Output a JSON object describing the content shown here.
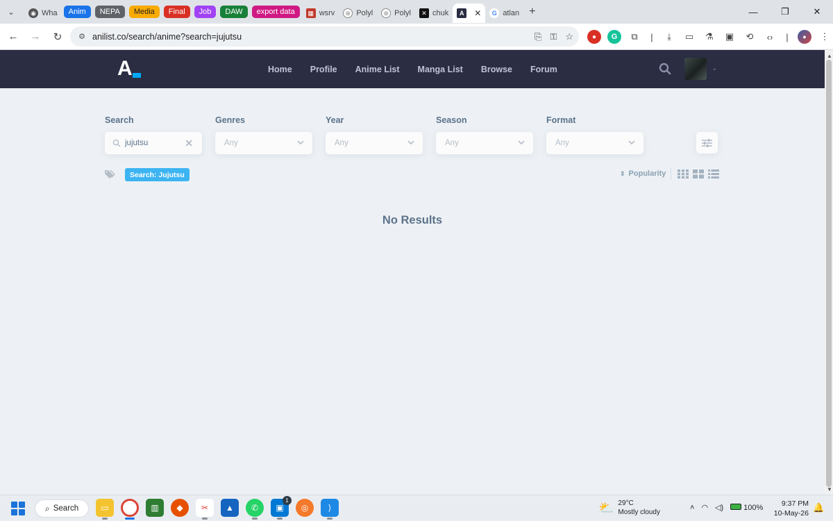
{
  "browser": {
    "tabs": [
      {
        "label": "Wha",
        "icon": "chrome-icon",
        "color": "#555555"
      },
      {
        "label": "Polyl",
        "icon": "globe-icon",
        "color": "#888888"
      },
      {
        "label": "Polyl",
        "icon": "globe-icon",
        "color": "#888888"
      },
      {
        "label": "chuk",
        "icon": "x-icon",
        "color": "#111111"
      },
      {
        "label": "wsrv",
        "icon": "image-icon",
        "color": "#c0392b"
      }
    ],
    "groups": [
      {
        "label": "Anim",
        "color": "#1a73e8"
      },
      {
        "label": "NEPA",
        "color": "#5f6368"
      },
      {
        "label": "Media",
        "color": "#f9ab00"
      },
      {
        "label": "Final",
        "color": "#d93025"
      },
      {
        "label": "Job",
        "color": "#a142f4"
      },
      {
        "label": "DAW",
        "color": "#188038"
      },
      {
        "label": "export data",
        "color": "#d01884"
      }
    ],
    "active_tab_label": "",
    "last_tab_label": "atlan",
    "url": "anilist.co/search/anime?search=jujutsu"
  },
  "site": {
    "logo": "A",
    "nav": [
      "Home",
      "Profile",
      "Anime List",
      "Manga List",
      "Browse",
      "Forum"
    ],
    "accent": "#3db4f2",
    "header_bg": "#2b2d42"
  },
  "filters": {
    "search": {
      "label": "Search",
      "value": "jujutsu"
    },
    "genres": {
      "label": "Genres",
      "value": "Any"
    },
    "year": {
      "label": "Year",
      "value": "Any"
    },
    "season": {
      "label": "Season",
      "value": "Any"
    },
    "format": {
      "label": "Format",
      "value": "Any"
    }
  },
  "active_tag": "Search: Jujutsu",
  "sort": {
    "label": "Popularity"
  },
  "results": {
    "empty_message": "No Results"
  },
  "taskbar": {
    "search_label": "Search",
    "weather": {
      "temp": "29°C",
      "desc": "Mostly cloudy"
    },
    "battery": "100%",
    "time": "9:37 PM",
    "date": "10-May-26",
    "notification_badge": "1"
  }
}
